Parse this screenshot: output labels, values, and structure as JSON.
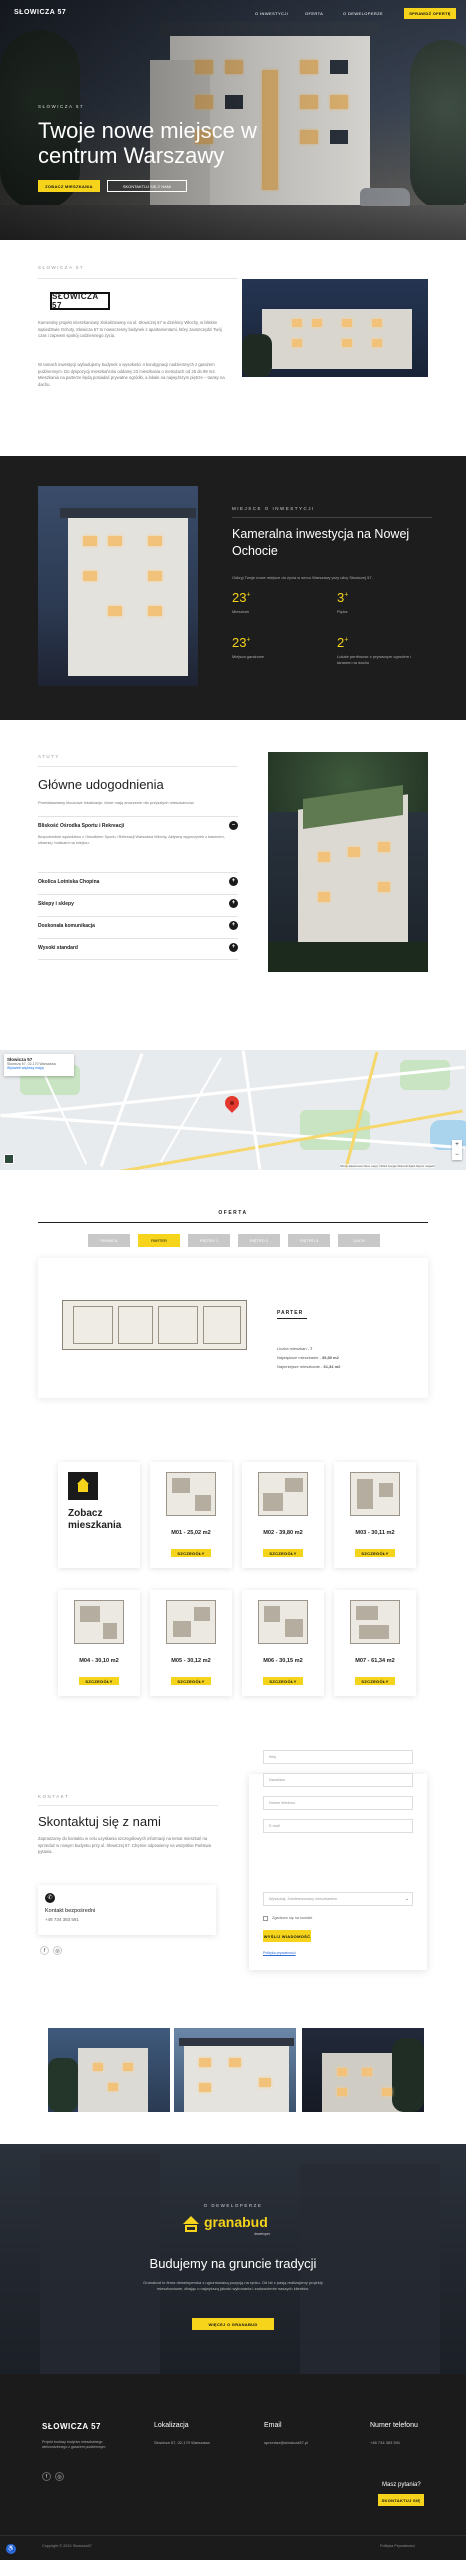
{
  "nav": {
    "logo": "SŁOWICZA 57",
    "items": [
      "O INWESTYCJI",
      "OFERTA",
      "O DEWELOPERZE"
    ],
    "cta": "SPRAWDŹ OFERTĘ"
  },
  "hero": {
    "eyebrow": "SŁOWICZA 57",
    "title": "Twoje nowe miejsce w centrum Warszawy",
    "btn_primary": "ZOBACZ MIESZKANIA",
    "btn_secondary": "SKONTAKTUJ SIĘ Z NAMI"
  },
  "about": {
    "eyebrow": "SŁOWICZA 57",
    "logo": "SŁOWICZA 57",
    "para1": "Kameralny projekt mieszkaniowy zlokalizowany na ul. Słowiczej 57 w dzielnicy Włochy, w bliskim sąsiedztwie Ochoty. Słowicza 57 to nowoczesny budynek z apartamentami, który zaoszczędzi Twój czas i zapewni spokój codziennego życia.",
    "para2": "W ramach inwestycji wybudujemy budynek o wysokości 4 kondygnacji nadziemnych z garażem podziemnym. Do dyspozycji mieszkańców oddamy 23 mieszkania o metrażach od 25 do 98 m2. Mieszkania na parterze będą posiadać prywatne ogródki, a lokale na najwyższym piętrze – tarasy na dachu."
  },
  "invest": {
    "eyebrow": "MIEJSCE O INWESTYCJI",
    "title": "Kameralna inwestycja na Nowej Ochocie",
    "desc": "Odkryj Twoje nowe miejsce do życia w sercu Warszawy przy ulicy Słowiczej 57.",
    "stats": [
      {
        "num": "23",
        "sup": "+",
        "label": "Mieszkań"
      },
      {
        "num": "3",
        "sup": "+",
        "label": "Piętra"
      },
      {
        "num": "23",
        "sup": "+",
        "label": "Miejsca garażowe"
      },
      {
        "num": "2",
        "sup": "+",
        "label": "Lokale penthouse z prywatnym ogrodem i tarasem na dachu"
      }
    ]
  },
  "amenities": {
    "eyebrow": "ATUTY",
    "title": "Główne udogodnienia",
    "intro": "Przedstawiamy kluczowe lokalizacje, które mają znaczenie dla przyszłych mieszkańców.",
    "items": [
      {
        "title": "Bliskość Ośrodka Sportu i Rekreacji",
        "open": true,
        "text": "Bezpośrednie sąsiedztwo z Ośrodkiem Sportu i Rekreacji Warszawa Włochy. Aktywny wypoczynek z basenem, siłownią i boiskami na miejscu."
      },
      {
        "title": "Okolica Lotniska Chopina",
        "open": false
      },
      {
        "title": "Sklepy i sklepy",
        "open": false
      },
      {
        "title": "Doskonała komunikacja",
        "open": false
      },
      {
        "title": "Wysoki standard",
        "open": false
      }
    ]
  },
  "map": {
    "place": "Słowicza 57",
    "address": "Słowicza 57, 02-170 Warszawa",
    "link": "Wyświetl większą mapę",
    "footer": "Skróty klawiszowe   Dane mapy ©2024 Google   Warunki   Zgłoś błąd w mapach"
  },
  "offer": {
    "heading": "OFERTA",
    "tabs": [
      "PIWNICA",
      "PARTER",
      "PIĘTRO 1",
      "PIĘTRO 2",
      "PIĘTRO 3",
      "DACH"
    ],
    "active_tab": 1,
    "floor_label": "PARTER",
    "info": [
      {
        "label": "Liczba mieszkań",
        "value": "7"
      },
      {
        "label": "Największe mieszkanie",
        "value": "39,80 m2"
      },
      {
        "label": "Najmniejsze mieszkanie",
        "value": "61,34 m2"
      }
    ],
    "see_all": "Zobacz mieszkania",
    "card_btn": "SZCZEGÓŁY",
    "units": [
      "M01 - 25,02 m2",
      "M02 - 39,80 m2",
      "M03 - 30,11 m2",
      "M04 - 30,10 m2",
      "M05 - 30,12 m2",
      "M06 - 30,15 m2",
      "M07 - 61,34 m2"
    ]
  },
  "contact": {
    "eyebrow": "KONTAKT",
    "title": "Skontaktuj się z nami",
    "para": "Zapraszamy do kontaktu w celu uzyskania szczegółowych informacji na temat mieszkań na sprzedaż w nowym budynku przy ul. Słowiczej 57. Chętnie odpowiemy na wszystkie Państwa pytania.",
    "box_label": "Kontakt bezpośredni",
    "phone": "+48 734 383 591",
    "fields": [
      "Imię",
      "Nazwisko",
      "Numer telefonu",
      "E-mail",
      "Wyszukaj: Zainteresowany mieszkaniem"
    ],
    "checkbox": "Zgadzam się na kontakt",
    "submit": "WYŚLIJ WIADOMOŚĆ",
    "policy": "Polityka prywatności"
  },
  "developer": {
    "eyebrow": "O DEWELOPERZE",
    "brand": "granabud",
    "brand_sub": "deweloper",
    "title": "Budujemy na gruncie tradycji",
    "para": "Granabud to firma deweloperska z ugruntowaną pozycją na rynku. Od lat z pasją realizujemy projekty mieszkaniowe, dbając o najwyższą jakość wykonania i zadowolenie naszych klientów.",
    "btn": "WIĘCEJ O GRANABUD"
  },
  "footer": {
    "logo": "SŁOWICZA 57",
    "tagline": "Projekt budowy budynku mieszkalnego wielorodzinnego z garażem podziemnym",
    "col1_h": "Lokalizacja",
    "col1_t": "Słowicza 57, 02-170 Warszawa",
    "col2_h": "Email",
    "col2_t": "sprzedaz@slowicza57.pl",
    "col3_h": "Numer telefonu",
    "col3_t": "+48 734 383 591",
    "ask": "Masz pytania?",
    "ask_btn": "SKONTAKTUJ SIĘ",
    "copyright": "Copyright © 2024 Słowicza57",
    "policy": "Polityka Prywatności"
  }
}
